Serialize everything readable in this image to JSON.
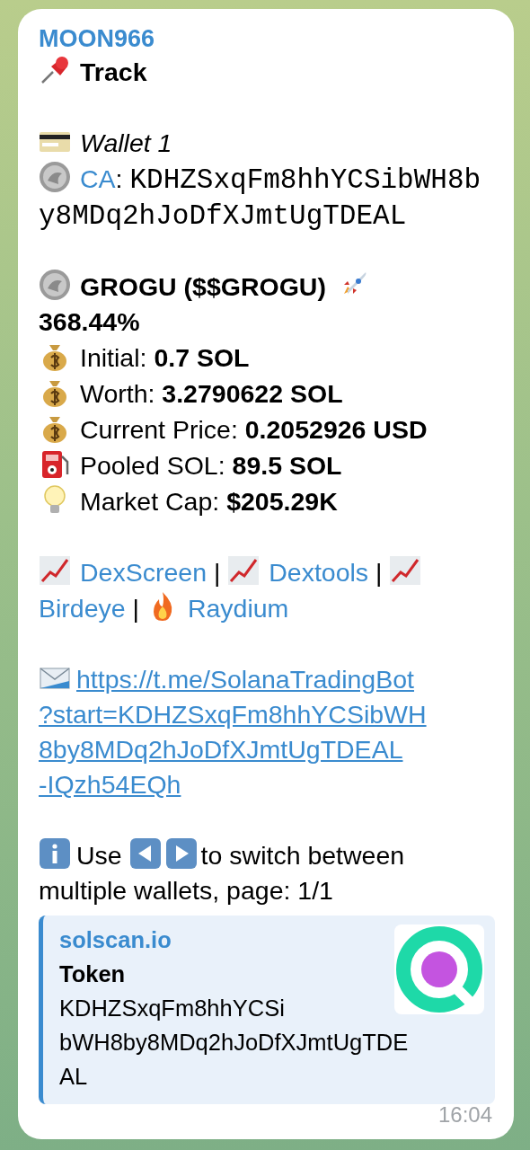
{
  "sender": "MOON966",
  "title": {
    "text": "Track"
  },
  "wallet": {
    "text": "Wallet 1"
  },
  "contract": {
    "label": "CA",
    "separator": ":",
    "value_lines": [
      "KDHZSxqFm8hhYCSibWH8b",
      "y8MDq2hJoDfXJmtUgTDEAL"
    ]
  },
  "token": {
    "name": "GROGU ($$GROGU)",
    "change": "368.44%"
  },
  "stats": [
    {
      "kind": "money",
      "label": "Initial:",
      "value": "0.7 SOL"
    },
    {
      "kind": "money",
      "label": "Worth:",
      "value": "3.2790622 SOL"
    },
    {
      "kind": "money",
      "label": "Current Price:",
      "value": "0.2052926 USD"
    },
    {
      "kind": "fuel",
      "label": "Pooled SOL:",
      "value": "89.5 SOL"
    },
    {
      "kind": "bulb",
      "label": "Market Cap:",
      "value": "$205.29K"
    }
  ],
  "links": [
    {
      "kind": "chart",
      "text": "DexScreen"
    },
    {
      "kind": "separator",
      "text": "|"
    },
    {
      "kind": "chart",
      "text": "Dextools"
    },
    {
      "kind": "separator",
      "text": "|"
    },
    {
      "kind": "chart",
      "text": "Birdeye"
    },
    {
      "kind": "separator",
      "text": "|"
    },
    {
      "kind": "fire",
      "text": "Raydium"
    }
  ],
  "bot_link": {
    "url_lines": [
      "https://t.me/SolanaTradingBot",
      "?start=KDHZSxqFm8hhYCSibWH",
      "8by8MDq2hJoDfXJmtUgTDEAL",
      "-IQzh54EQh"
    ]
  },
  "note": {
    "before": "Use",
    "after_lines": [
      "to switch between",
      "multiple wallets, page: 1/1"
    ]
  },
  "preview": {
    "site": "solscan.io",
    "title": "Token",
    "description_lines": [
      "KDHZSxqFm8hhYCSi",
      "bWH8by8MDq2hJoDfXJmtUgTDE",
      "AL"
    ]
  },
  "time": "16:04"
}
